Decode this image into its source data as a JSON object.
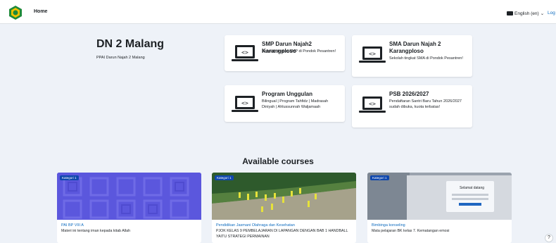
{
  "nav": {
    "home": "Home",
    "language": "English (en)",
    "login": "Log"
  },
  "site": {
    "title": "DN 2 Malang",
    "subtitle": "PPAI Darun Najah 2 Malang"
  },
  "cards": [
    {
      "title": "SMP Darun Najah2 Karangploso",
      "desc": "Sekolah tingkat SMP di Pondok Pesantren!"
    },
    {
      "title": "SMA Darun Najah 2 Karangploso",
      "desc": "Sekolah tingkat SMA di Pondok Pesantren!"
    },
    {
      "title": "Program Unggulan",
      "desc": "Bilingual | Program Tahfidz | Madrasah Diniyah | Ahlussunnah Waljamaah"
    },
    {
      "title": "PSB 2026/2027",
      "desc": "Pendaftaran Santri Baru Tahun 2026/2027 sudah dibuka, kuota terbatas!"
    }
  ],
  "available_courses": "Available courses",
  "courses": [
    {
      "badge": "Kategori 1",
      "name": "PAI BP VIII A",
      "summary": "Materi ini tentang iman kepada kitab Allah"
    },
    {
      "badge": "Kategori 1",
      "name": "Pendidikan Jasmani Olahraga dan Kesehatan",
      "summary": "PJOK KELAS 9 PEMBELAJARAN DI LAPANGAN DENGAN BAB 1 HANDBALL YAITU STRATEGI PERMAINAN"
    },
    {
      "badge": "Kategori 1",
      "name": "Bimbinga konseling",
      "summary": "Mata pelajaran BK kelas 7. Kematangan emosi"
    }
  ],
  "screen_text": "Selamat datang",
  "help": "?",
  "colors": {
    "link": "#0f6cbf",
    "badge": "#0f47ad",
    "background": "#eef2f8",
    "purple": "#5b57dd"
  }
}
